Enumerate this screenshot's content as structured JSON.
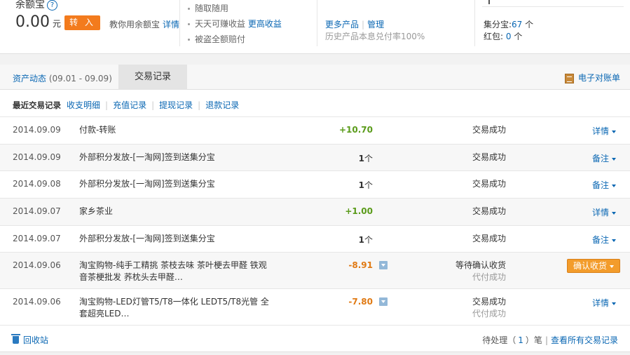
{
  "summary": {
    "yeb_title": "余额宝",
    "help_icon": "?",
    "amount": "0.00",
    "amount_unit": "元",
    "transfer_in": "转 入",
    "teach_text": "教你用余额宝",
    "teach_link": "详情",
    "features": [
      "随取随用",
      "天天可赚收益",
      "被盗全额赔付"
    ],
    "more_earnings": "更高收益",
    "more_products": "更多产品",
    "manage": "管理",
    "history_note": "历史产品本息兑付率100%",
    "jifenbao_label": "集分宝:",
    "jifenbao_value": "67",
    "jifenbao_unit": " 个",
    "hongbao_label": "红包:",
    "hongbao_value": "0",
    "hongbao_unit": " 个"
  },
  "tabs": {
    "asset_label": "资产动态",
    "asset_date": "(09.01 - 09.09)",
    "trade_label": "交易记录",
    "ebill": "电子对账单"
  },
  "subnav": {
    "current": "最近交易记录",
    "links": [
      "收支明细",
      "充值记录",
      "提现记录",
      "退款记录"
    ]
  },
  "rows": [
    {
      "date": "2014.09.09",
      "desc": "付款-转账",
      "amount": "+10.70",
      "unit": "",
      "status": "交易成功",
      "sub": "",
      "action": "详情"
    },
    {
      "date": "2014.09.09",
      "desc": "外部积分发放-[一淘网]签到送集分宝",
      "amount": "1",
      "unit": "个",
      "status": "交易成功",
      "sub": "",
      "action": "备注"
    },
    {
      "date": "2014.09.08",
      "desc": "外部积分发放-[一淘网]签到送集分宝",
      "amount": "1",
      "unit": "个",
      "status": "交易成功",
      "sub": "",
      "action": "备注"
    },
    {
      "date": "2014.09.07",
      "desc": "家乡茶业",
      "amount": "+1.00",
      "unit": "",
      "status": "交易成功",
      "sub": "",
      "action": "详情"
    },
    {
      "date": "2014.09.07",
      "desc": "外部积分发放-[一淘网]签到送集分宝",
      "amount": "1",
      "unit": "个",
      "status": "交易成功",
      "sub": "",
      "action": "备注"
    },
    {
      "date": "2014.09.06",
      "desc": "淘宝购物-纯手工精挑 茶枝去味 茶叶梗去甲醛 铁观音茶梗批发 荞枕头去甲醛…",
      "amount": "-8.91",
      "unit": "",
      "status": "等待确认收货",
      "sub": "代付成功",
      "action": "确认收货"
    },
    {
      "date": "2014.09.06",
      "desc": "淘宝购物-LED灯管T5/T8一体化 LEDT5/T8光管 全套超亮LED…",
      "amount": "-7.80",
      "unit": "",
      "status": "交易成功",
      "sub": "代付成功",
      "action": "详情"
    }
  ],
  "footer": {
    "recycle": "回收站",
    "pending_prefix": "待处理（",
    "pending_count": "1",
    "pending_suffix": "）笔",
    "view_all": "查看所有交易记录"
  }
}
